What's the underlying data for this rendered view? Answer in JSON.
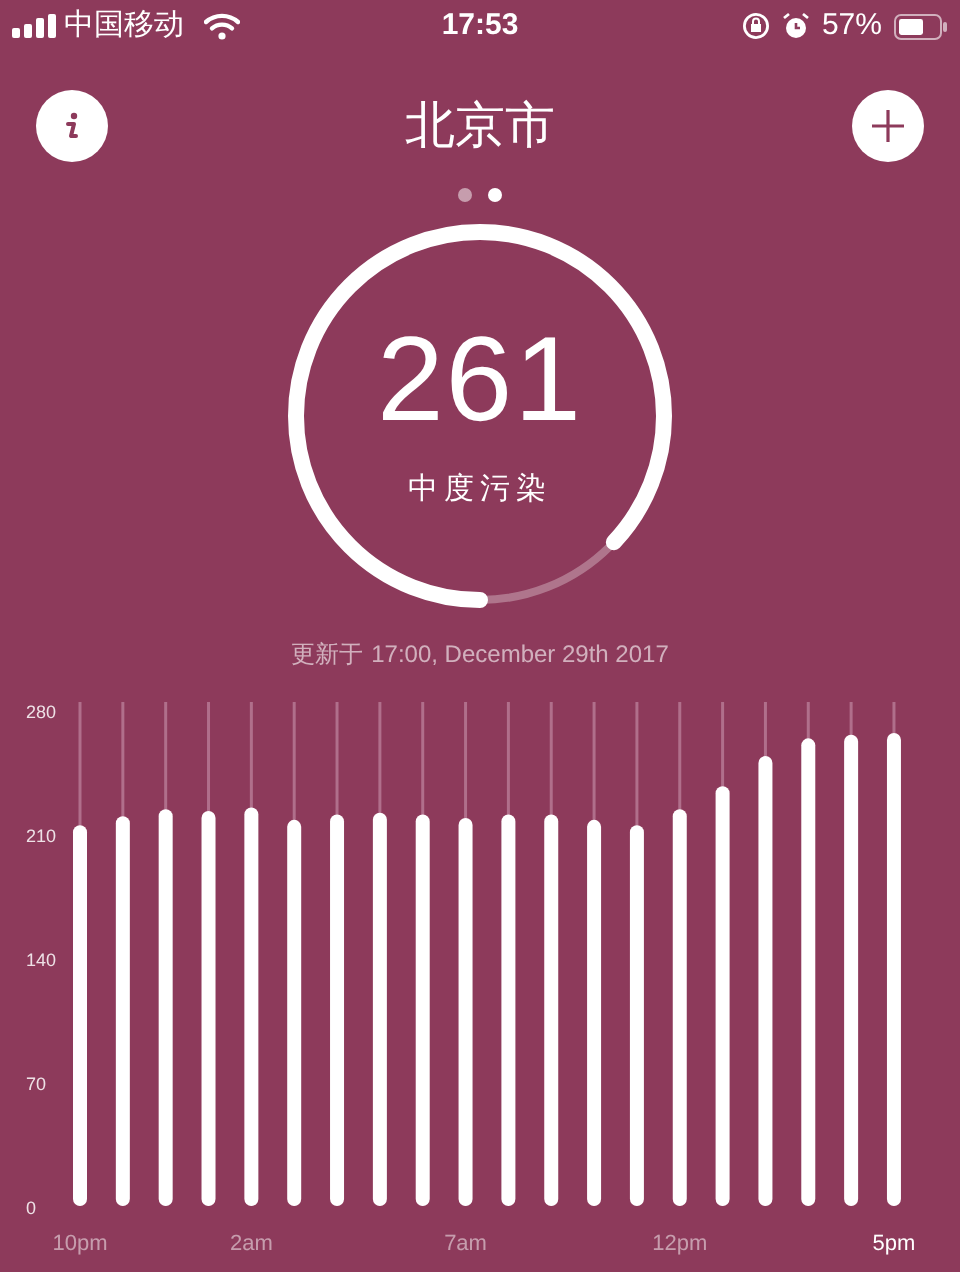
{
  "status_bar": {
    "carrier": "中国移动",
    "time": "17:53",
    "battery": "57%"
  },
  "header": {
    "title": "北京市",
    "page_dots": [
      {
        "selected": false
      },
      {
        "selected": true
      }
    ]
  },
  "gauge": {
    "value": "261",
    "category": "中度污染",
    "level": 0.87
  },
  "updated": {
    "label": "更新于",
    "time": "17:00, December 29th 2017"
  },
  "chart": {
    "chart_data": {
      "type": "bar",
      "grid": true,
      "ylim": [
        0,
        280
      ],
      "yticks": [
        0,
        70,
        140,
        210,
        280
      ],
      "categories": [
        "10pm",
        null,
        null,
        null,
        "2am",
        null,
        null,
        null,
        null,
        "7am",
        null,
        null,
        null,
        null,
        "12pm",
        null,
        null,
        null,
        null,
        "5pm"
      ],
      "values": [
        215,
        220,
        224,
        223,
        225,
        218,
        221,
        222,
        221,
        219,
        221,
        221,
        218,
        215,
        224,
        237,
        254,
        264,
        266,
        267
      ]
    }
  }
}
